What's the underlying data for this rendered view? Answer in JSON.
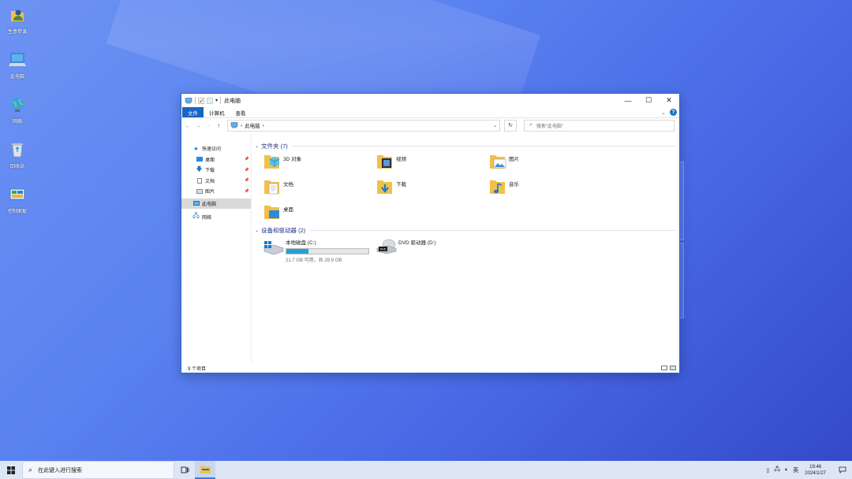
{
  "desktop": {
    "icons": [
      {
        "label": "生意参谋",
        "icon": "user-folder-icon"
      },
      {
        "label": "此电脑",
        "icon": "computer-icon"
      },
      {
        "label": "网络",
        "icon": "network-globe-icon"
      },
      {
        "label": "回收站",
        "icon": "recycle-bin-icon"
      },
      {
        "label": "控制面板",
        "icon": "control-panel-icon"
      }
    ]
  },
  "window": {
    "title": "此电脑",
    "controls": {
      "minimize": "—",
      "maximize": "☐",
      "close": "✕"
    },
    "ribbon_tabs": [
      "文件",
      "计算机",
      "查看"
    ],
    "address": {
      "path_segments": [
        "此电脑"
      ],
      "separator": "›",
      "dropdown": "⌄",
      "refresh": "↻"
    },
    "search_placeholder": "搜索\"此电脑\"",
    "nav_pane": {
      "quick_access": "快速访问",
      "pinned": [
        "桌面",
        "下载",
        "文档",
        "图片"
      ],
      "this_pc": "此电脑",
      "network": "网络"
    },
    "groups": {
      "folders_header": "文件夹 (7)",
      "devices_header": "设备和驱动器 (2)"
    },
    "folders": [
      {
        "name": "3D 对象",
        "icon": "3d-objects-folder-icon"
      },
      {
        "name": "视频",
        "icon": "videos-folder-icon"
      },
      {
        "name": "图片",
        "icon": "pictures-folder-icon"
      },
      {
        "name": "文档",
        "icon": "documents-folder-icon"
      },
      {
        "name": "下载",
        "icon": "downloads-folder-icon"
      },
      {
        "name": "音乐",
        "icon": "music-folder-icon"
      },
      {
        "name": "桌面",
        "icon": "desktop-folder-icon"
      }
    ],
    "drives": [
      {
        "name": "本地磁盘 (C:)",
        "usage_fraction": 0.27,
        "free_text": "21.7 GB 可用，共 29.9 GB",
        "icon": "windows-drive-icon"
      },
      {
        "name": "DVD 驱动器 (D:)",
        "icon": "dvd-drive-icon"
      }
    ],
    "status": "9 个项目"
  },
  "taskbar": {
    "search_placeholder": "在此键入进行搜索",
    "tray": {
      "lang": "英",
      "time": "19:46",
      "date": "2024/1/27"
    }
  },
  "colors": {
    "accent": "#1966c2",
    "folder": "#f2c04a",
    "drive_bar": "#26a0da"
  }
}
